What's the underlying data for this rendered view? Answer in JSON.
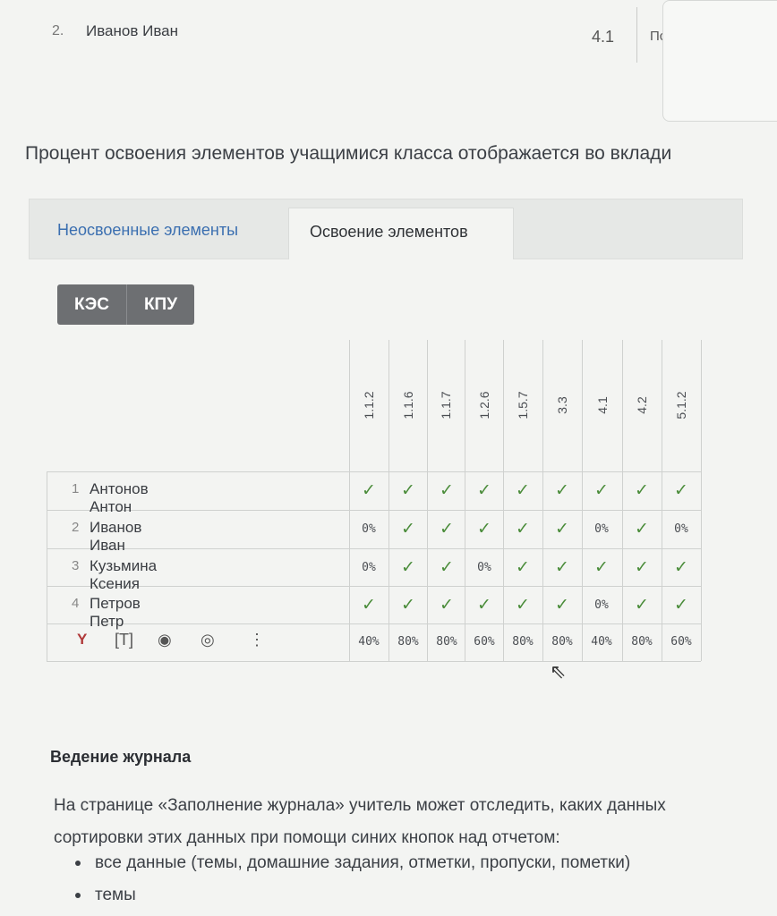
{
  "top_row": {
    "num": "2.",
    "name": "Иванов Иван",
    "score": "4.1",
    "cut_text": "Пс"
  },
  "intro_text": "Процент освоения элементов учащимися класса отображается во вклади",
  "tabs": [
    {
      "label": "Неосвоенные элементы",
      "active": false
    },
    {
      "label": "Освоение элементов",
      "active": true
    }
  ],
  "toggle": {
    "left": "КЭС",
    "right": "КПУ",
    "selected": "КЭС"
  },
  "table": {
    "columns": [
      "1.1.2",
      "1.1.6",
      "1.1.7",
      "1.2.6",
      "1.5.7",
      "3.3",
      "4.1",
      "4.2",
      "5.1.2"
    ],
    "rows": [
      {
        "num": "1",
        "name": "Антонов Антон",
        "cells": [
          "✓",
          "✓",
          "✓",
          "✓",
          "✓",
          "✓",
          "✓",
          "✓",
          "✓"
        ]
      },
      {
        "num": "2",
        "name": "Иванов Иван",
        "cells": [
          "0%",
          "✓",
          "✓",
          "✓",
          "✓",
          "✓",
          "0%",
          "✓",
          "0%"
        ]
      },
      {
        "num": "3",
        "name": "Кузьмина Ксения",
        "cells": [
          "0%",
          "✓",
          "✓",
          "0%",
          "✓",
          "✓",
          "✓",
          "✓",
          "✓"
        ]
      },
      {
        "num": "4",
        "name": "Петров Петр",
        "cells": [
          "✓",
          "✓",
          "✓",
          "✓",
          "✓",
          "✓",
          "0%",
          "✓",
          "✓"
        ]
      }
    ],
    "totals": [
      "40%",
      "80%",
      "80%",
      "60%",
      "80%",
      "80%",
      "40%",
      "80%",
      "60%"
    ],
    "check_color": "#4a8c3a"
  },
  "toolbar_icons": [
    "filter-icon",
    "text-icon",
    "eye-icon",
    "camera-icon",
    "more-icon"
  ],
  "section": {
    "title": "Ведение журнала",
    "para_line1": "На странице «Заполнение журнала» учитель может отследить, каких данных",
    "para_line2": "сортировки этих данных при помощи синих кнопок над отчетом:",
    "bullets": [
      "все данные (темы, домашние задания, отметки, пропуски, пометки)",
      "темы"
    ]
  }
}
